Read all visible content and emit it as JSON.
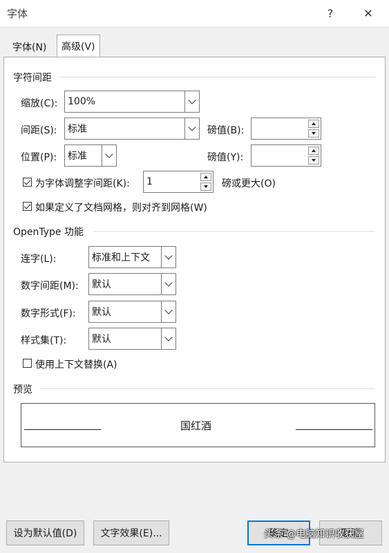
{
  "window": {
    "title": "字体",
    "help_glyph": "?",
    "close_glyph": "✕"
  },
  "tabs": [
    {
      "label": "字体(N)",
      "active": false
    },
    {
      "label": "高级(V)",
      "active": true
    }
  ],
  "char_spacing": {
    "section_title": "字符间距",
    "scale_label": "缩放(C):",
    "scale_value": "100%",
    "spacing_label": "间距(S):",
    "spacing_value": "标准",
    "spacing_by_label": "磅值(B):",
    "spacing_by_value": "",
    "position_label": "位置(P):",
    "position_value": "标准",
    "position_by_label": "磅值(Y):",
    "position_by_value": "",
    "kerning_label": "为字体调整字间距(K):",
    "kerning_checked": true,
    "kerning_value": "1",
    "kerning_suffix": "磅或更大(O)",
    "grid_label": "如果定义了文档网格，则对齐到网格(W)",
    "grid_checked": true
  },
  "opentype": {
    "section_title": "OpenType 功能",
    "ligatures_label": "连字(L):",
    "ligatures_value": "标准和上下文",
    "num_spacing_label": "数字间距(M):",
    "num_spacing_value": "默认",
    "num_forms_label": "数字形式(F):",
    "num_forms_value": "默认",
    "stylistic_label": "样式集(T):",
    "stylistic_value": "默认",
    "contextual_label": "使用上下文替换(A)",
    "contextual_checked": false
  },
  "preview": {
    "section_title": "预览",
    "sample_text": "国红酒"
  },
  "buttons": {
    "set_default": "设为默认值(D)",
    "text_effects": "文字效果(E)...",
    "ok": "确定",
    "cancel": "取消"
  },
  "watermark": "头条 @电脑知识收获屋",
  "colors": {
    "focus_border": "#0078d7",
    "background": "#f0f0f0"
  }
}
